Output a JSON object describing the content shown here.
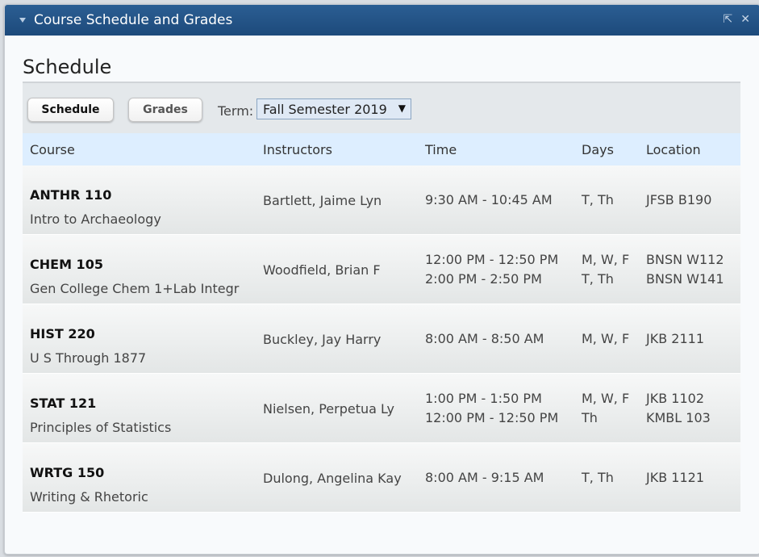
{
  "panel": {
    "title": "Course Schedule and Grades",
    "section_title": "Schedule",
    "tools": {
      "expand": "⇱",
      "close": "✕"
    }
  },
  "toolbar": {
    "schedule_label": "Schedule",
    "grades_label": "Grades",
    "term_label": "Term:",
    "term_value": "Fall Semester 2019"
  },
  "table": {
    "headers": [
      "Course",
      "Instructors",
      "Time",
      "Days",
      "Location"
    ],
    "rows": [
      {
        "code": "ANTHR 110",
        "name": "Intro to Archaeology",
        "instructor": "Bartlett, Jaime Lyn",
        "times": [
          "9:30 AM - 10:45 AM"
        ],
        "days": [
          "T, Th"
        ],
        "locations": [
          "JFSB B190"
        ]
      },
      {
        "code": "CHEM 105",
        "name": "Gen College Chem 1+Lab Integr",
        "instructor": "Woodfield, Brian F",
        "times": [
          "12:00 PM - 12:50 PM",
          "2:00 PM - 2:50 PM"
        ],
        "days": [
          "M, W, F",
          "T, Th"
        ],
        "locations": [
          "BNSN W112",
          "BNSN W141"
        ]
      },
      {
        "code": "HIST 220",
        "name": "U S Through 1877",
        "instructor": "Buckley, Jay Harry",
        "times": [
          "8:00 AM - 8:50 AM"
        ],
        "days": [
          "M, W, F"
        ],
        "locations": [
          "JKB 2111"
        ]
      },
      {
        "code": "STAT 121",
        "name": "Principles of Statistics",
        "instructor": "Nielsen, Perpetua Ly",
        "times": [
          "1:00 PM - 1:50 PM",
          "12:00 PM - 12:50 PM"
        ],
        "days": [
          "M, W, F",
          "Th"
        ],
        "locations": [
          "JKB 1102",
          "KMBL 103"
        ]
      },
      {
        "code": "WRTG 150",
        "name": "Writing & Rhetoric",
        "instructor": "Dulong, Angelina Kay",
        "times": [
          "8:00 AM - 9:15 AM"
        ],
        "days": [
          "T, Th"
        ],
        "locations": [
          "JKB 1121"
        ]
      }
    ]
  }
}
